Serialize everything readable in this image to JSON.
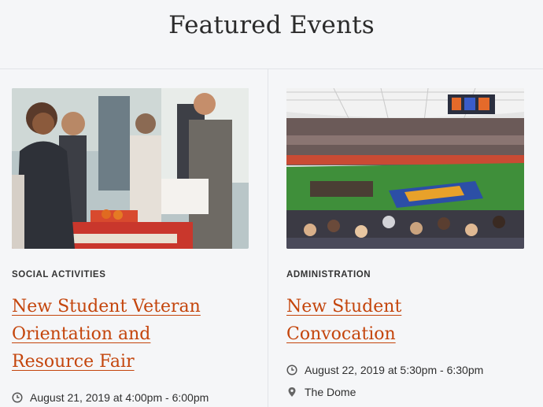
{
  "section": {
    "title": "Featured Events"
  },
  "events": [
    {
      "category": "SOCIAL ACTIVITIES",
      "title": "New Student Veteran Orientation and Resource Fair",
      "date": "August 21, 2019 at 4:00pm - 6:00pm",
      "image": "resource-fair-photo"
    },
    {
      "category": "ADMINISTRATION",
      "title": "New Student Convocation",
      "date": "August 22, 2019 at 5:30pm - 6:30pm",
      "location": "The Dome",
      "image": "dome-stadium-photo"
    }
  ],
  "colors": {
    "link": "#c4450c",
    "text": "#2f2f2f",
    "background": "#f5f6f8"
  },
  "icons": {
    "date": "clock-icon",
    "location": "map-pin-icon"
  }
}
